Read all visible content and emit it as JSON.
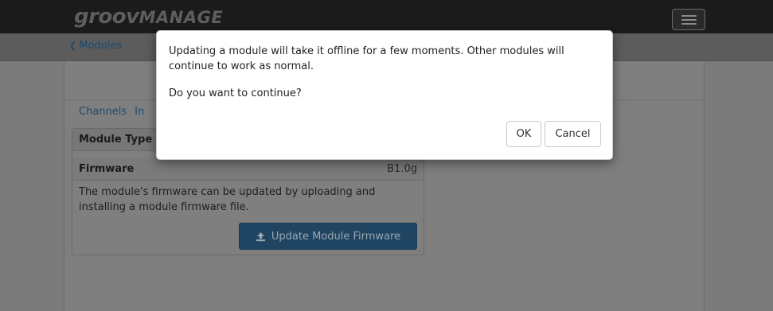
{
  "app": {
    "logo_part1": "groov",
    "logo_part2": "MANAGE"
  },
  "breadcrumb": {
    "back_label": "Modules",
    "chevron": "❮"
  },
  "tabs": [
    {
      "label": "Channels"
    },
    {
      "label": "In"
    }
  ],
  "module_info": {
    "header_label": "Module Type",
    "firmware_label": "Firmware",
    "firmware_value": "B1.0g",
    "description": "The module's firmware can be updated by uploading and installing a module firmware file.",
    "update_button_label": "Update Module Firmware",
    "update_icon": "upload-icon"
  },
  "dialog": {
    "message": "Updating a module will take it offline for a few moments. Other modules will continue to work as normal.",
    "question": "Do you want to continue?",
    "ok_label": "OK",
    "cancel_label": "Cancel"
  },
  "colors": {
    "link": "#1d4a6d",
    "primary_button": "#1f4563",
    "overlay_dim": "#7b7b7b"
  }
}
